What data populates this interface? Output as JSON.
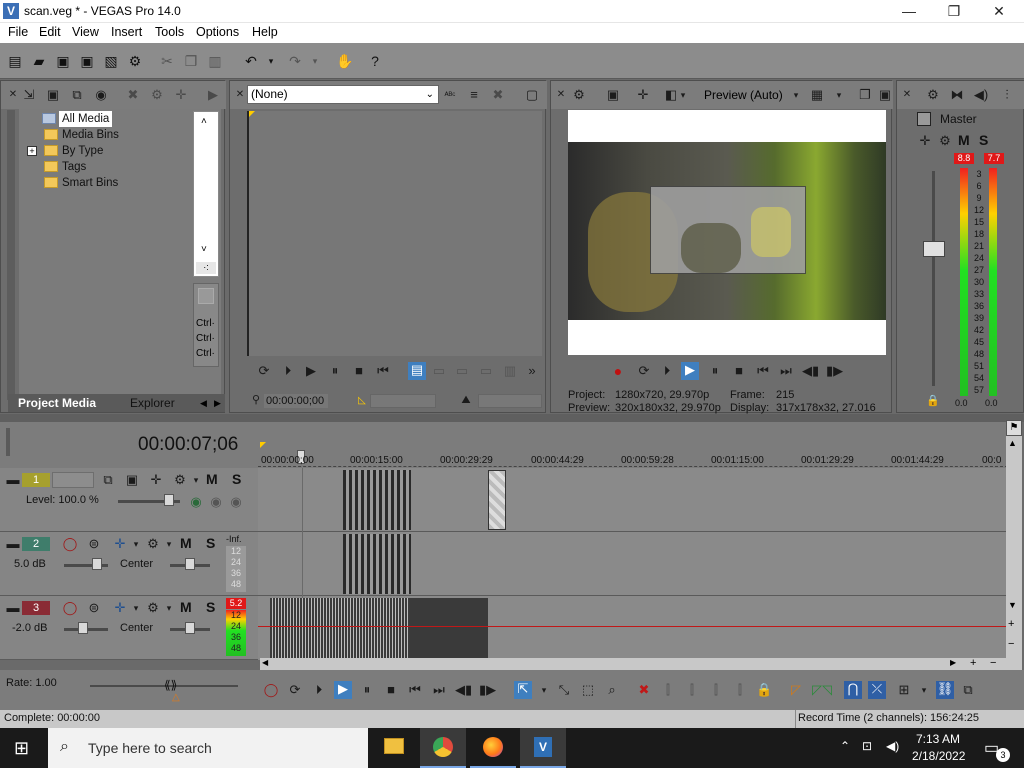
{
  "window": {
    "title": "scan.veg * - VEGAS Pro 14.0",
    "minimize": "—",
    "maximize": "❐",
    "close": "✕"
  },
  "menu": [
    "File",
    "Edit",
    "View",
    "Insert",
    "Tools",
    "Options",
    "Help"
  ],
  "project_media": {
    "tree": [
      "All Media",
      "Media Bins",
      "By Type",
      "Tags",
      "Smart Bins"
    ],
    "expand_marker": "+",
    "tabs": [
      "Project Media",
      "Explorer"
    ],
    "side_buttons": [
      "Ctrl·",
      "Ctrl·",
      "Ctrl·"
    ],
    "scroll_marker": "·:"
  },
  "trimmer": {
    "dropdown": "(None)",
    "timecode": "00:00:00;00"
  },
  "preview": {
    "mode": "Preview (Auto)",
    "project_label": "Project:",
    "project_value": "1280x720, 29.970p",
    "preview_label": "Preview:",
    "preview_value": "320x180x32, 29.970p",
    "frame_label": "Frame:",
    "frame_value": "215",
    "display_label": "Display:",
    "display_value": "317x178x32, 27.016"
  },
  "master": {
    "label": "Master",
    "m_label": "M",
    "s_label": "S",
    "peak_left": "8.8",
    "peak_right": "7.7",
    "scale": [
      "3",
      "6",
      "9",
      "12",
      "15",
      "18",
      "21",
      "24",
      "27",
      "30",
      "33",
      "36",
      "39",
      "42",
      "45",
      "48",
      "51",
      "54",
      "57"
    ],
    "bottom_left": "0.0",
    "bottom_right": "0.0"
  },
  "timeline": {
    "timecode": "00:00:07;06",
    "ruler": [
      "00:00:00;00",
      "00:00:15:00",
      "00:00:29:29",
      "00:00:44:29",
      "00:00:59:28",
      "00:01:15:00",
      "00:01:29:29",
      "00:01:44:29",
      "00:0"
    ],
    "tracks": [
      {
        "num": "1",
        "level": "Level: 100.0 %",
        "m": "M",
        "s": "S"
      },
      {
        "num": "2",
        "vol": "5.0 dB",
        "pan": "Center",
        "m": "M",
        "s": "S",
        "meter_top": "-Inf.",
        "meter_scale": [
          "12",
          "24",
          "36",
          "48"
        ]
      },
      {
        "num": "3",
        "vol": "-2.0 dB",
        "pan": "Center",
        "m": "M",
        "s": "S",
        "meter_top": "5.2",
        "meter_scale": [
          "12",
          "24",
          "36",
          "48"
        ]
      }
    ],
    "rate": "Rate: 1.00"
  },
  "status": {
    "left": "Complete: 00:00:00",
    "right": "Record Time (2 channels): 156:24:25"
  },
  "taskbar": {
    "search_placeholder": "Type here to search",
    "time": "7:13 AM",
    "date": "2/18/2022",
    "notifications": "3"
  },
  "colors": {
    "track1": "#a6a02e",
    "track2": "#3f7d6b",
    "track3": "#8a2b35",
    "accent_blue": "#2f6fb5"
  }
}
